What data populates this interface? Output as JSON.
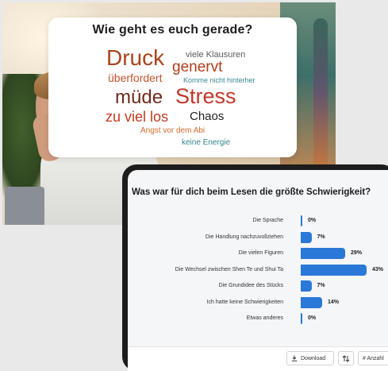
{
  "wordcloud": {
    "title": "Wie geht es euch gerade?",
    "words": [
      {
        "text": "Druck",
        "color": "#a8441c"
      },
      {
        "text": "viele Klausuren",
        "color": "#5a5a5a"
      },
      {
        "text": "genervt",
        "color": "#b03d18"
      },
      {
        "text": "überfordert",
        "color": "#c0542a"
      },
      {
        "text": "Komme nicht hinterher",
        "color": "#3a8a93"
      },
      {
        "text": "müde",
        "color": "#6e2a1c"
      },
      {
        "text": "Stress",
        "color": "#c4362a"
      },
      {
        "text": "zu viel los",
        "color": "#c0391e"
      },
      {
        "text": "Chaos",
        "color": "#222222"
      },
      {
        "text": "Angst vor dem Abi",
        "color": "#d2692c"
      },
      {
        "text": "keine Energie",
        "color": "#2f8690"
      }
    ]
  },
  "poll": {
    "question": "Was war für dich beim Lesen die größte Schwierigkeit?",
    "bar_color": "#2a78d8",
    "rows": [
      {
        "label": "Die Sprache",
        "percent": 0,
        "text": "0%"
      },
      {
        "label": "Die Handlung nachzuvollziehen",
        "percent": 7,
        "text": "7%"
      },
      {
        "label": "Die vielen Figuren",
        "percent": 29,
        "text": "29%"
      },
      {
        "label": "Die Wechsel zwischen Shen Te und Shui Ta",
        "percent": 43,
        "text": "43%"
      },
      {
        "label": "Die Grundidee des Stücks",
        "percent": 7,
        "text": "7%"
      },
      {
        "label": "Ich hatte keine Schwierigkeiten",
        "percent": 14,
        "text": "14%"
      },
      {
        "label": "Etwas anderes",
        "percent": 0,
        "text": "0%"
      }
    ],
    "footer": {
      "download_label": "Download",
      "sort_icon": "sort-arrows-icon",
      "count_label": "# Anzahl"
    }
  }
}
